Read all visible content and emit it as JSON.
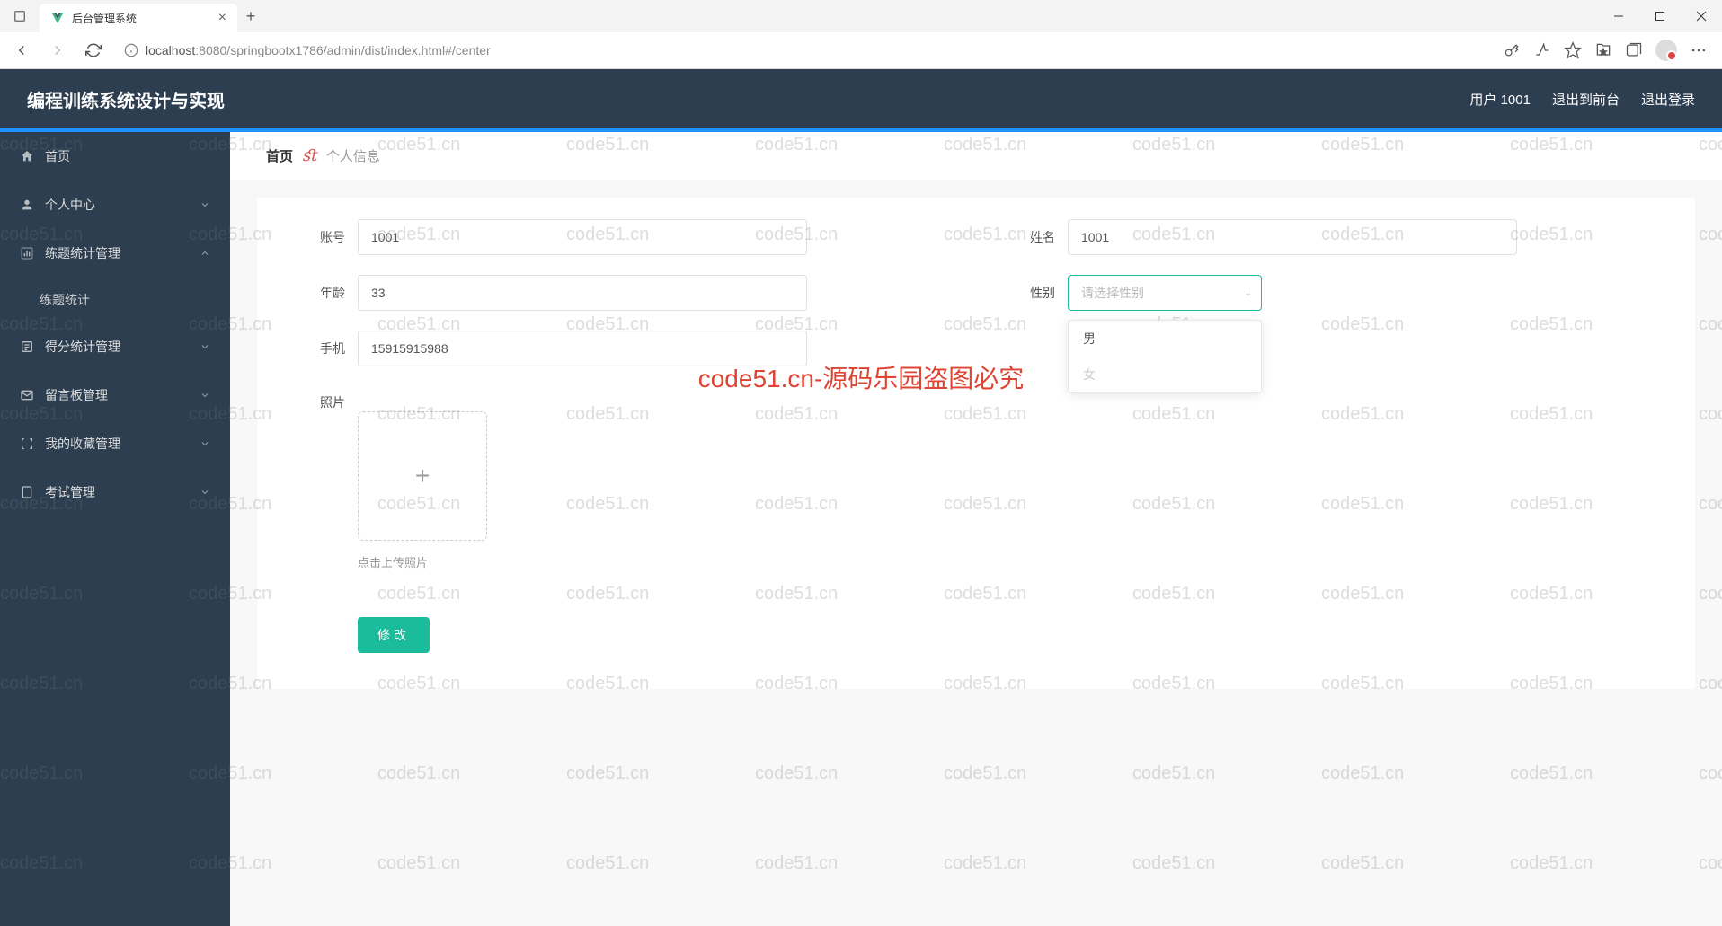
{
  "browser": {
    "tab_title": "后台管理系统",
    "url_host": "localhost",
    "url_port_path": ":8080/springbootx1786/admin/dist/index.html#/center"
  },
  "header": {
    "app_title": "编程训练系统设计与实现",
    "user_label": "用户 1001",
    "logout_front": "退出到前台",
    "logout": "退出登录"
  },
  "sidebar": {
    "items": [
      {
        "label": "首页",
        "icon": "home",
        "expandable": false
      },
      {
        "label": "个人中心",
        "icon": "user",
        "expandable": true
      },
      {
        "label": "练题统计管理",
        "icon": "chart",
        "expandable": true,
        "open": true
      },
      {
        "label": "得分统计管理",
        "icon": "list",
        "expandable": true
      },
      {
        "label": "留言板管理",
        "icon": "message",
        "expandable": true
      },
      {
        "label": "我的收藏管理",
        "icon": "star",
        "expandable": true
      },
      {
        "label": "考试管理",
        "icon": "doc",
        "expandable": true
      }
    ],
    "submenu_exercise": "练题统计"
  },
  "breadcrumb": {
    "home": "首页",
    "current": "个人信息"
  },
  "form": {
    "account_label": "账号",
    "account_value": "1001",
    "name_label": "姓名",
    "name_value": "1001",
    "age_label": "年龄",
    "age_value": "33",
    "gender_label": "性别",
    "gender_placeholder": "请选择性别",
    "gender_options": [
      "男",
      "女"
    ],
    "phone_label": "手机",
    "phone_value": "15915915988",
    "photo_label": "照片",
    "upload_hint": "点击上传照片",
    "submit": "修改"
  },
  "watermark": {
    "text": "code51.cn",
    "main": "code51.cn-源码乐园盗图必究"
  }
}
